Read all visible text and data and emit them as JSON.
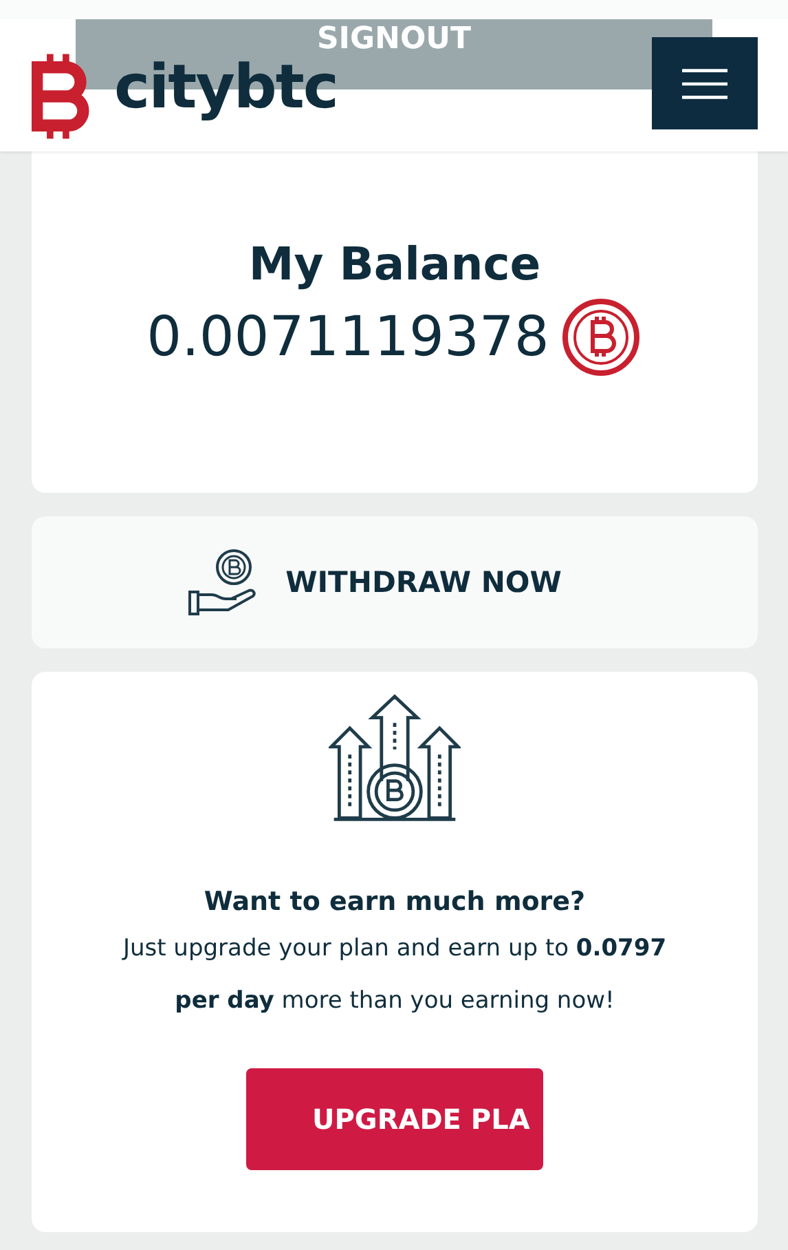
{
  "header": {
    "signout": "SIGNOUT",
    "logo_text": "citybtc"
  },
  "balance": {
    "title": "My Balance",
    "amount": "0.0071119378"
  },
  "withdraw": {
    "label": "WITHDRAW NOW"
  },
  "upgrade": {
    "heading": "Want to earn much more?",
    "text": "Just upgrade your plan and earn up to **0.0797 per day** more than you earning now!",
    "button": "UPGRADE PLA"
  }
}
